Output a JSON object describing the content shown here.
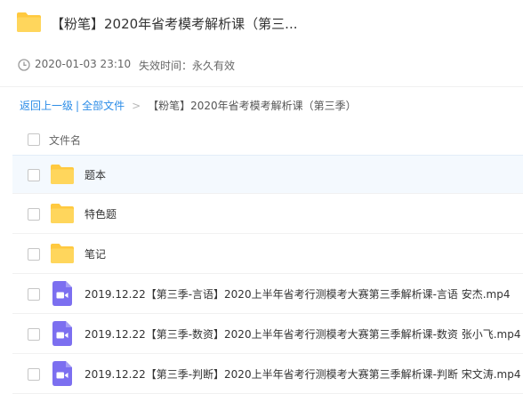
{
  "header": {
    "title": "【粉笔】2020年省考模考解析课（第三...",
    "folder_icon": "folder-icon"
  },
  "meta": {
    "date": "2020-01-03 23:10",
    "expiry": "失效时间：永久有效"
  },
  "breadcrumb": {
    "back": "返回上一级",
    "separator": "|",
    "all_files": "全部文件",
    "arrow": ">",
    "current": "【粉笔】2020年省考模考解析课（第三季）"
  },
  "list": {
    "header_label": "文件名",
    "items": [
      {
        "name": "题本",
        "type": "folder"
      },
      {
        "name": "特色题",
        "type": "folder"
      },
      {
        "name": "笔记",
        "type": "folder"
      },
      {
        "name": "2019.12.22【第三季-言语】2020上半年省考行测模考大赛第三季解析课-言语 安杰.mp4",
        "type": "video"
      },
      {
        "name": "2019.12.22【第三季-数资】2020上半年省考行测模考大赛第三季解析课-数资 张小飞.mp4",
        "type": "video"
      },
      {
        "name": "2019.12.22【第三季-判断】2020上半年省考行测模考大赛第三季解析课-判断 宋文涛.mp4",
        "type": "video"
      }
    ]
  },
  "colors": {
    "link": "#2b8ce7",
    "folder": "#ffc93f",
    "video": "#7c6ff0",
    "selected_row": "#f4f9fe"
  }
}
